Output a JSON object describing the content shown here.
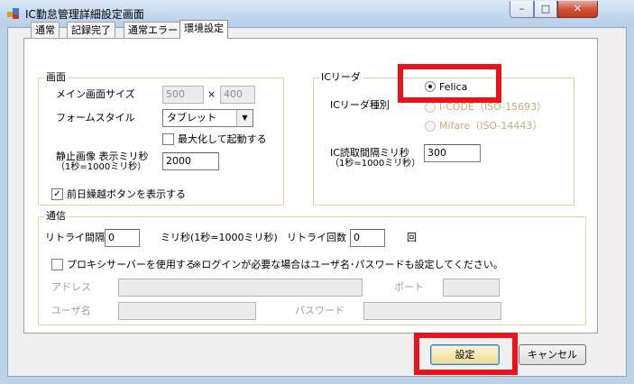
{
  "window": {
    "title": "IC勤怠管理詳細設定画面",
    "minimize": "–",
    "maximize": "□",
    "close": "✕"
  },
  "tabs": [
    {
      "label": "通常"
    },
    {
      "label": "記録完了"
    },
    {
      "label": "通常エラー"
    },
    {
      "label": "環境設定"
    }
  ],
  "screen_group": {
    "legend": "画面",
    "main_size_label": "メイン画面サイズ",
    "width_value": "500",
    "times": "×",
    "height_value": "400",
    "form_style_label": "フォームスタイル",
    "form_style_value": "タブレット",
    "maximize_label": "最大化して起動する",
    "still_image_label_1": "静止画像 表示ミリ秒",
    "still_image_label_2": "（1秒=1000ミリ秒）",
    "still_image_value": "2000",
    "prev_day_label": "前日繰越ボタンを表示する",
    "prev_day_checked": "✓"
  },
  "reader_group": {
    "legend": "ICリーダ",
    "type_label": "ICリーダ種別",
    "options": [
      {
        "label": "Felica"
      },
      {
        "label": "I-CODE（ISO-15693）"
      },
      {
        "label": "Mifare（ISO-14443）"
      }
    ],
    "interval_label_1": "IC読取間隔ミリ秒",
    "interval_label_2": "（1秒=1000ミリ秒）",
    "interval_value": "300"
  },
  "comm_group": {
    "legend": "通信",
    "retry_interval_label": "リトライ間隔",
    "retry_interval_value": "0",
    "retry_interval_unit": "ミリ秒(1秒=1000ミリ秒)",
    "retry_count_label": "リトライ回数",
    "retry_count_value": "0",
    "retry_count_unit": "回",
    "proxy_label": "プロキシサーバーを使用する",
    "proxy_note": "※ログインが必要な場合はユーザ名･パスワードも設定してください。",
    "address_label": "アドレス",
    "port_label": "ポート",
    "user_label": "ユーザ名",
    "password_label": "パスワード"
  },
  "footer": {
    "ok_label": "設定",
    "cancel_label": "キャンセル"
  },
  "colors": {
    "highlight": "#e8131b"
  }
}
